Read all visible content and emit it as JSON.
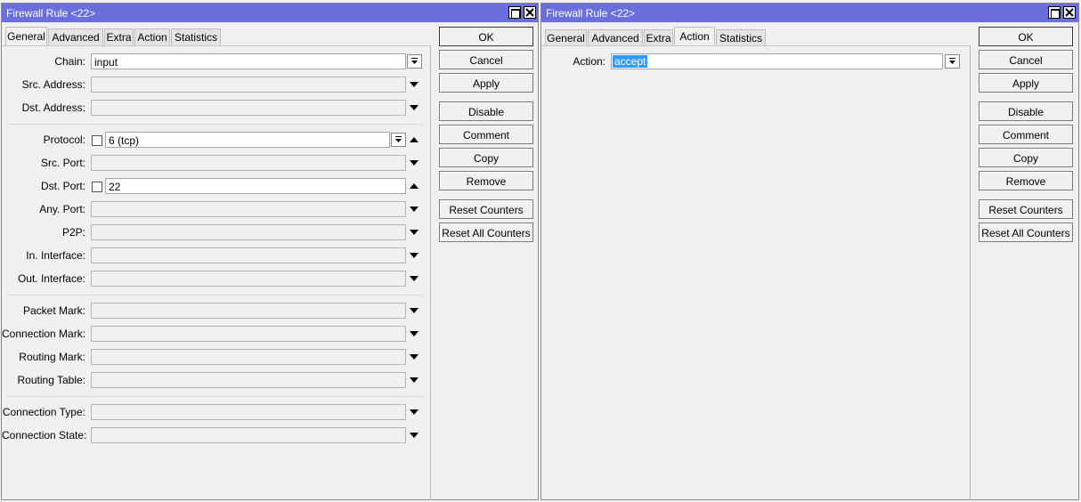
{
  "left_window": {
    "title": "Firewall Rule <22>",
    "tabs": [
      "General",
      "Advanced",
      "Extra",
      "Action",
      "Statistics"
    ],
    "active_tab": "General",
    "fields": {
      "chain": {
        "label": "Chain:",
        "value": "input"
      },
      "src_address": {
        "label": "Src. Address:",
        "value": ""
      },
      "dst_address": {
        "label": "Dst. Address:",
        "value": ""
      },
      "protocol": {
        "label": "Protocol:",
        "value": "6 (tcp)"
      },
      "src_port": {
        "label": "Src. Port:",
        "value": ""
      },
      "dst_port": {
        "label": "Dst. Port:",
        "value": "22"
      },
      "any_port": {
        "label": "Any. Port:",
        "value": ""
      },
      "p2p": {
        "label": "P2P:",
        "value": ""
      },
      "in_interface": {
        "label": "In. Interface:",
        "value": ""
      },
      "out_interface": {
        "label": "Out. Interface:",
        "value": ""
      },
      "packet_mark": {
        "label": "Packet Mark:",
        "value": ""
      },
      "connection_mark": {
        "label": "Connection Mark:",
        "value": ""
      },
      "routing_mark": {
        "label": "Routing Mark:",
        "value": ""
      },
      "routing_table": {
        "label": "Routing Table:",
        "value": ""
      },
      "connection_type": {
        "label": "Connection Type:",
        "value": ""
      },
      "connection_state": {
        "label": "Connection State:",
        "value": ""
      }
    }
  },
  "right_window": {
    "title": "Firewall Rule <22>",
    "tabs": [
      "General",
      "Advanced",
      "Extra",
      "Action",
      "Statistics"
    ],
    "active_tab": "Action",
    "fields": {
      "action": {
        "label": "Action:",
        "value": "accept"
      }
    }
  },
  "buttons": {
    "ok": "OK",
    "cancel": "Cancel",
    "apply": "Apply",
    "disable": "Disable",
    "comment": "Comment",
    "copy": "Copy",
    "remove": "Remove",
    "reset_counters": "Reset Counters",
    "reset_all_counters": "Reset All Counters"
  },
  "icons": {
    "maximize": "maximize-icon",
    "close": "close-icon",
    "dropdown": "dropdown-arrow-icon",
    "collapse": "collapse-up-icon"
  },
  "colors": {
    "titlebar": "#6b6fdd",
    "selection": "#3399ff",
    "window_bg": "#f0f0f0"
  }
}
